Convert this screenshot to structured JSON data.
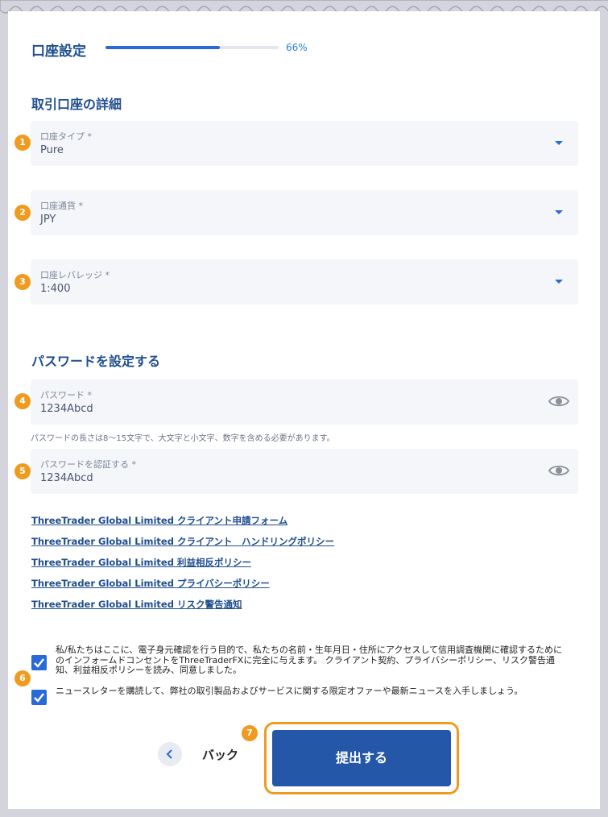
{
  "header": {
    "step_title": "口座設定",
    "progress_text": "66%",
    "progress_value": 0.66
  },
  "section_account": {
    "title": "取引口座の詳細"
  },
  "fields": {
    "account_type": {
      "badge": "1",
      "label": "口座タイプ *",
      "value": "Pure",
      "icon": "chevron-down-icon"
    },
    "currency": {
      "badge": "2",
      "label": "口座通貨 *",
      "value": "JPY",
      "icon": "chevron-down-icon"
    },
    "leverage": {
      "badge": "3",
      "label": "口座レバレッジ *",
      "value": "1:400",
      "icon": "chevron-down-icon"
    },
    "password": {
      "badge": "4",
      "label": "パスワード *",
      "value": "1234Abcd",
      "icon": "eye-icon"
    },
    "password_confirm": {
      "badge": "5",
      "label": "パスワードを認証する *",
      "value": "1234Abcd",
      "icon": "eye-icon"
    }
  },
  "section_password": {
    "title": "パスワードを設定する"
  },
  "password_hint": "パスワードの長さは8〜15文字で、大文字と小文字、数字を含める必要があります。",
  "links": [
    "ThreeTrader Global Limited クライアント申請フォーム",
    "ThreeTrader Global Limited クライアント　ハンドリングポリシー",
    "ThreeTrader Global Limited 利益相反ポリシー",
    "ThreeTrader Global Limited プライバシーポリシー",
    "ThreeTrader Global Limited リスク警告通知"
  ],
  "consent": {
    "badge": "6",
    "items": [
      "私/私たちはここに、電子身元確認を行う目的で、私たちの名前・生年月日・住所にアクセスして信用調査機関に確認するためにのインフォームドコンセントをThreeTraderFXに完全に与えます。 クライアント契約、プライバシーポリシー、リスク警告通知、利益相反ポリシーを読み、同意しました。",
      "ニュースレターを購読して、弊社の取引製品およびサービスに関する限定オファーや最新ニュースを入手しましょう。"
    ]
  },
  "footer": {
    "back_label": "バック",
    "submit_badge": "7",
    "submit_label": "提出する"
  },
  "colors": {
    "brand_blue": "#2457a8",
    "accent_blue": "#2a6ad8",
    "badge_orange": "#f09a1f"
  }
}
